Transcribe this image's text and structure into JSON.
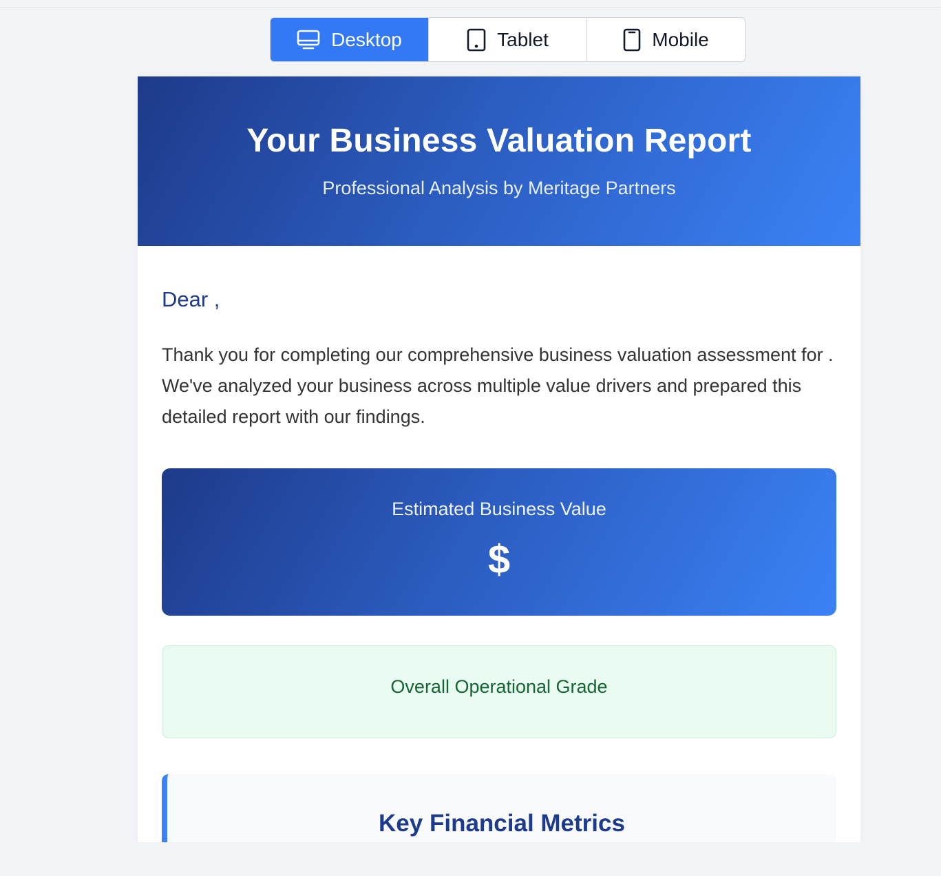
{
  "device_switcher": {
    "options": [
      {
        "label": "Desktop",
        "icon": "desktop-icon",
        "active": true
      },
      {
        "label": "Tablet",
        "icon": "tablet-icon",
        "active": false
      },
      {
        "label": "Mobile",
        "icon": "mobile-icon",
        "active": false
      }
    ],
    "active_color": "#3379f6"
  },
  "email": {
    "header": {
      "title": "Your Business Valuation Report",
      "subtitle": "Professional Analysis by Meritage Partners"
    },
    "greeting": "Dear ,",
    "intro": "Thank you for completing our comprehensive business valuation assessment for . We've analyzed your business across multiple value drivers and prepared this detailed report with our findings.",
    "value_card": {
      "label": "Estimated Business Value",
      "amount": "$"
    },
    "grade_card": {
      "label": "Overall Operational Grade"
    },
    "metrics_card": {
      "title": "Key Financial Metrics"
    }
  },
  "colors": {
    "brand_dark": "#1e3a8a",
    "brand_light": "#3b82f6",
    "grade_bg": "#eafcf2",
    "grade_text": "#166534"
  }
}
